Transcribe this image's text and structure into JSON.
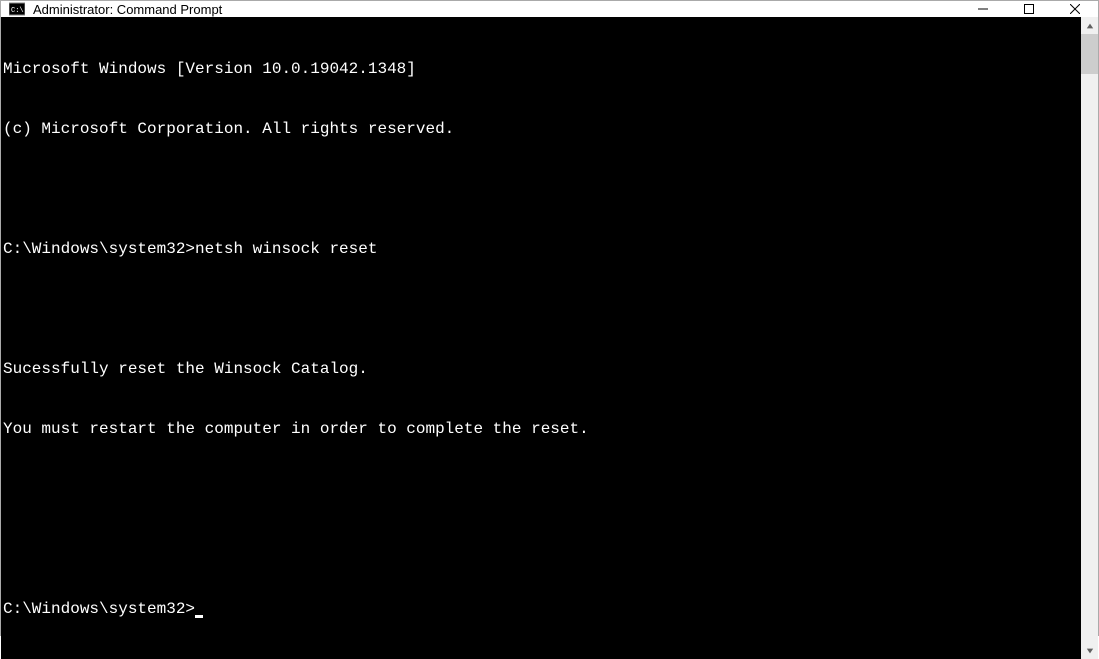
{
  "titlebar": {
    "title": "Administrator: Command Prompt"
  },
  "terminal": {
    "lines": [
      "Microsoft Windows [Version 10.0.19042.1348]",
      "(c) Microsoft Corporation. All rights reserved.",
      "",
      "C:\\Windows\\system32>netsh winsock reset",
      "",
      "Sucessfully reset the Winsock Catalog.",
      "You must restart the computer in order to complete the reset.",
      "",
      ""
    ],
    "prompt": "C:\\Windows\\system32>"
  }
}
